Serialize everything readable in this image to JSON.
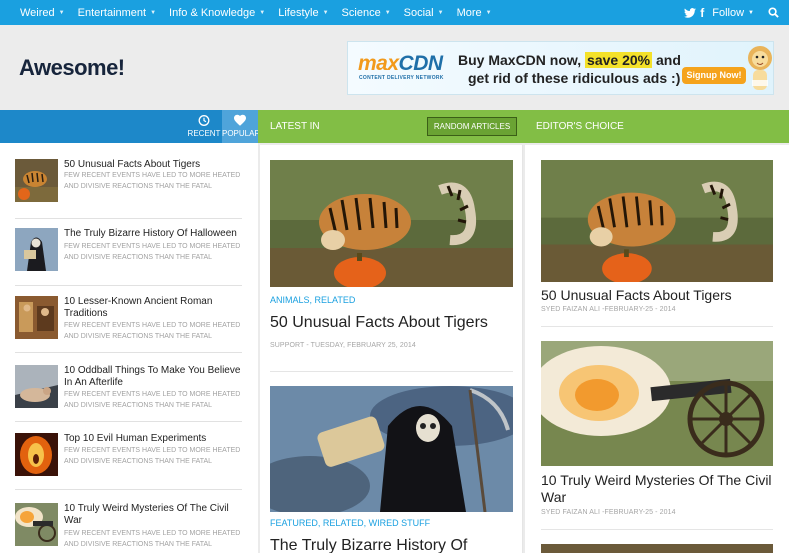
{
  "nav": {
    "items": [
      "Weired",
      "Entertainment",
      "Info & Knowledge",
      "Lifestyle",
      "Science",
      "Social",
      "More"
    ],
    "follow_label": "Follow",
    "icons": [
      "twitter-icon",
      "facebook-icon",
      "search-icon"
    ]
  },
  "header": {
    "logo": "Awesome!",
    "ad": {
      "brand_max": "max",
      "brand_cdn": "CDN",
      "tagline": "CONTENT DELIVERY NETWORK",
      "copy_line1_pre": "Buy MaxCDN now, ",
      "copy_line1_highlight": "save 20%",
      "copy_line1_post": " and",
      "copy_line2": "get rid of these ridiculous ads :)",
      "cta": "Signup Now!"
    }
  },
  "tabs": {
    "recent": "RECENT",
    "popular": "POPULAR",
    "latest": "LATEST IN",
    "random": "RANDOM ARTICLES",
    "editors": "EDITOR'S CHOICE"
  },
  "sidebar": {
    "items": [
      {
        "title": "50 Unusual Facts About Tigers",
        "excerpt": "FEW RECENT EVENTS HAVE LED TO MORE HEATED AND DIVISIVE REACTIONS THAN THE FATAL"
      },
      {
        "title": "The Truly Bizarre History Of Halloween",
        "excerpt": "FEW RECENT EVENTS HAVE LED TO MORE HEATED AND DIVISIVE REACTIONS THAN THE FATAL"
      },
      {
        "title": "10 Lesser-Known Ancient Roman Traditions",
        "excerpt": "FEW RECENT EVENTS HAVE LED TO MORE HEATED AND DIVISIVE REACTIONS THAN THE FATAL"
      },
      {
        "title": "10 Oddball Things To Make You Believe In An Afterlife",
        "excerpt": "FEW RECENT EVENTS HAVE LED TO MORE HEATED AND DIVISIVE REACTIONS THAN THE FATAL"
      },
      {
        "title": "Top 10 Evil Human Experiments",
        "excerpt": "FEW RECENT EVENTS HAVE LED TO MORE HEATED AND DIVISIVE REACTIONS THAN THE FATAL"
      },
      {
        "title": "10 Truly Weird Mysteries Of The Civil War",
        "excerpt": "FEW RECENT EVENTS HAVE LED TO MORE HEATED AND DIVISIVE REACTIONS THAN THE FATAL"
      }
    ]
  },
  "latest": {
    "posts": [
      {
        "categories": "ANIMALS, RELATED",
        "title": "50 Unusual Facts About Tigers",
        "meta": "SUPPORT - TUESDAY, FEBRUARY 25, 2014"
      },
      {
        "categories": "FEATURED, RELATED, WIRED STUFF",
        "title": "The Truly Bizarre History Of"
      }
    ]
  },
  "editors": {
    "posts": [
      {
        "title": "50 Unusual Facts About Tigers",
        "meta": "SYED FAIZAN ALI -FEBRUARY-25 - 2014"
      },
      {
        "title": "10 Truly Weird Mysteries Of The Civil War",
        "meta": "SYED FAIZAN ALI -FEBRUARY-25 - 2014"
      }
    ]
  },
  "colors": {
    "nav_bg": "#1aa0e0",
    "tab_blue": "#1d88c9",
    "tab_green": "#82be45",
    "link_blue": "#1aa0e0"
  }
}
